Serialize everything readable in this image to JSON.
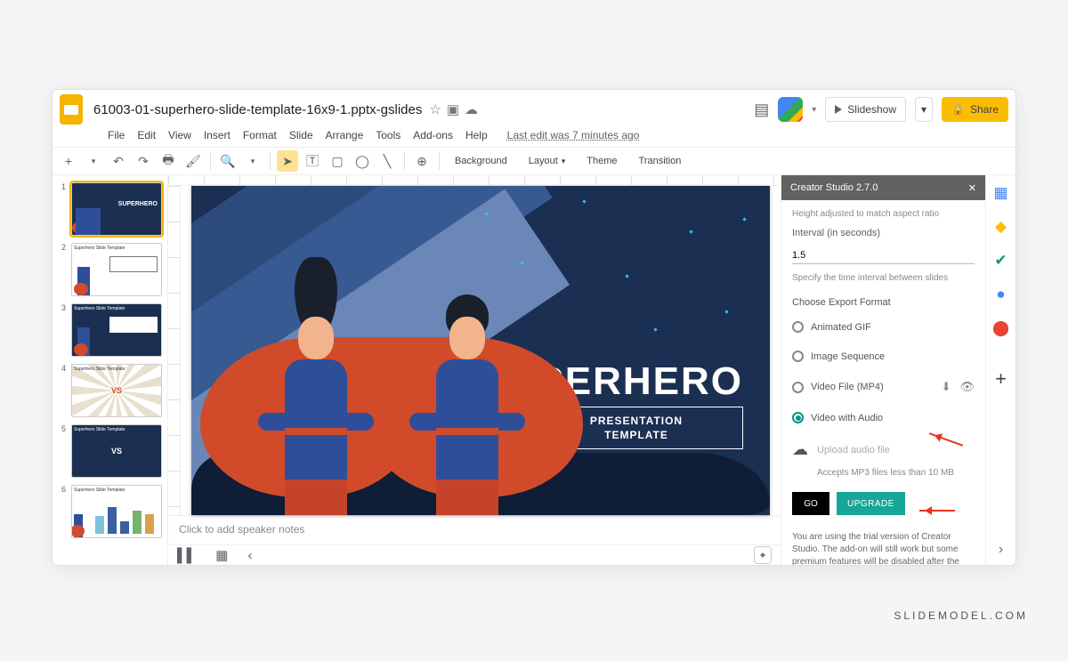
{
  "doc_title": "61003-01-superhero-slide-template-16x9-1.pptx-gslides",
  "last_edit": "Last edit was 7 minutes ago",
  "menu": [
    "File",
    "Edit",
    "View",
    "Insert",
    "Format",
    "Slide",
    "Arrange",
    "Tools",
    "Add-ons",
    "Help"
  ],
  "header_buttons": {
    "slideshow": "Slideshow",
    "share": "Share"
  },
  "toolbar_buttons": {
    "background": "Background",
    "layout": "Layout",
    "theme": "Theme",
    "transition": "Transition"
  },
  "slide": {
    "title": "SUPERHERO",
    "subtitle_line1": "PRESENTATION",
    "subtitle_line2": "TEMPLATE"
  },
  "notes_placeholder": "Click to add speaker notes",
  "thumbs": [
    {
      "n": "1",
      "label": "SUPERHERO"
    },
    {
      "n": "2",
      "label": "Superhero Slide Template"
    },
    {
      "n": "3",
      "label": "Superhero Slide Template"
    },
    {
      "n": "4",
      "label": "Superhero Slide Template"
    },
    {
      "n": "5",
      "label": "Superhero Slide Template"
    },
    {
      "n": "6",
      "label": "Superhero Slide Template"
    }
  ],
  "sidebar": {
    "title": "Creator Studio 2.7.0",
    "height_note": "Height adjusted to match aspect ratio",
    "interval_label": "Interval (in seconds)",
    "interval_value": "1.5",
    "interval_hint": "Specify the time interval between slides",
    "format_label": "Choose Export Format",
    "formats": {
      "gif": "Animated GIF",
      "seq": "Image Sequence",
      "mp4": "Video File (MP4)",
      "audio": "Video with Audio"
    },
    "upload_placeholder": "Upload audio file",
    "upload_hint": "Accepts MP3 files less than 10 MB",
    "go_btn": "GO",
    "upgrade_btn": "UPGRADE",
    "trial_text": "You are using the trial version of Creator Studio. The add-on will still work but some premium features will be disabled after the trial expires."
  },
  "watermark": "SLIDEMODEL.COM"
}
